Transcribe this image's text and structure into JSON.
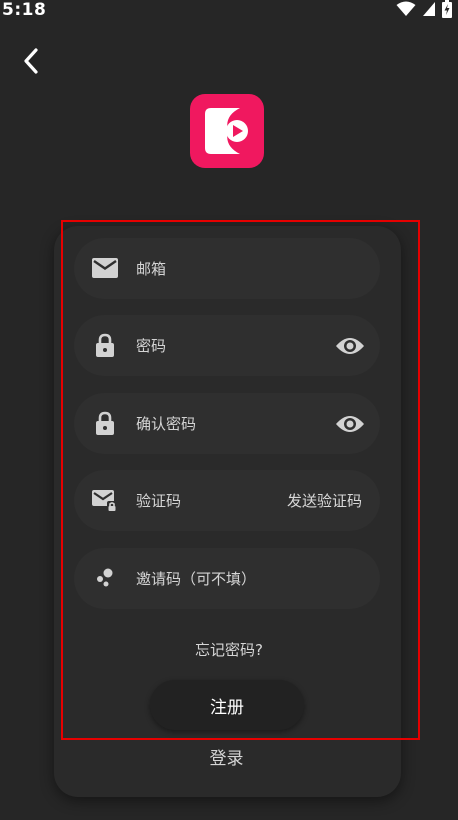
{
  "status_bar": {
    "time": "5:18",
    "icons": [
      "wifi-icon",
      "signal-icon",
      "battery-charging-icon"
    ]
  },
  "header": {
    "back_icon": "chevron-left-icon",
    "logo_icon": "play-logo-icon",
    "logo_color": "#f0185f"
  },
  "form": {
    "email": {
      "placeholder": "邮箱",
      "icon": "mail-icon"
    },
    "password": {
      "placeholder": "密码",
      "icon": "lock-icon",
      "toggle_icon": "eye-icon"
    },
    "confirm_password": {
      "placeholder": "确认密码",
      "icon": "lock-icon",
      "toggle_icon": "eye-icon"
    },
    "verification_code": {
      "placeholder": "验证码",
      "icon": "mail-lock-icon",
      "send_label": "发送验证码"
    },
    "invite_code": {
      "placeholder": "邀请码（可不填）",
      "icon": "invite-dots-icon"
    },
    "forgot_password": "忘记密码?",
    "register_label": "注册",
    "login_label": "登录"
  },
  "colors": {
    "background": "#262626",
    "field_background": "#2f2f2f",
    "highlight": "#e60000"
  }
}
